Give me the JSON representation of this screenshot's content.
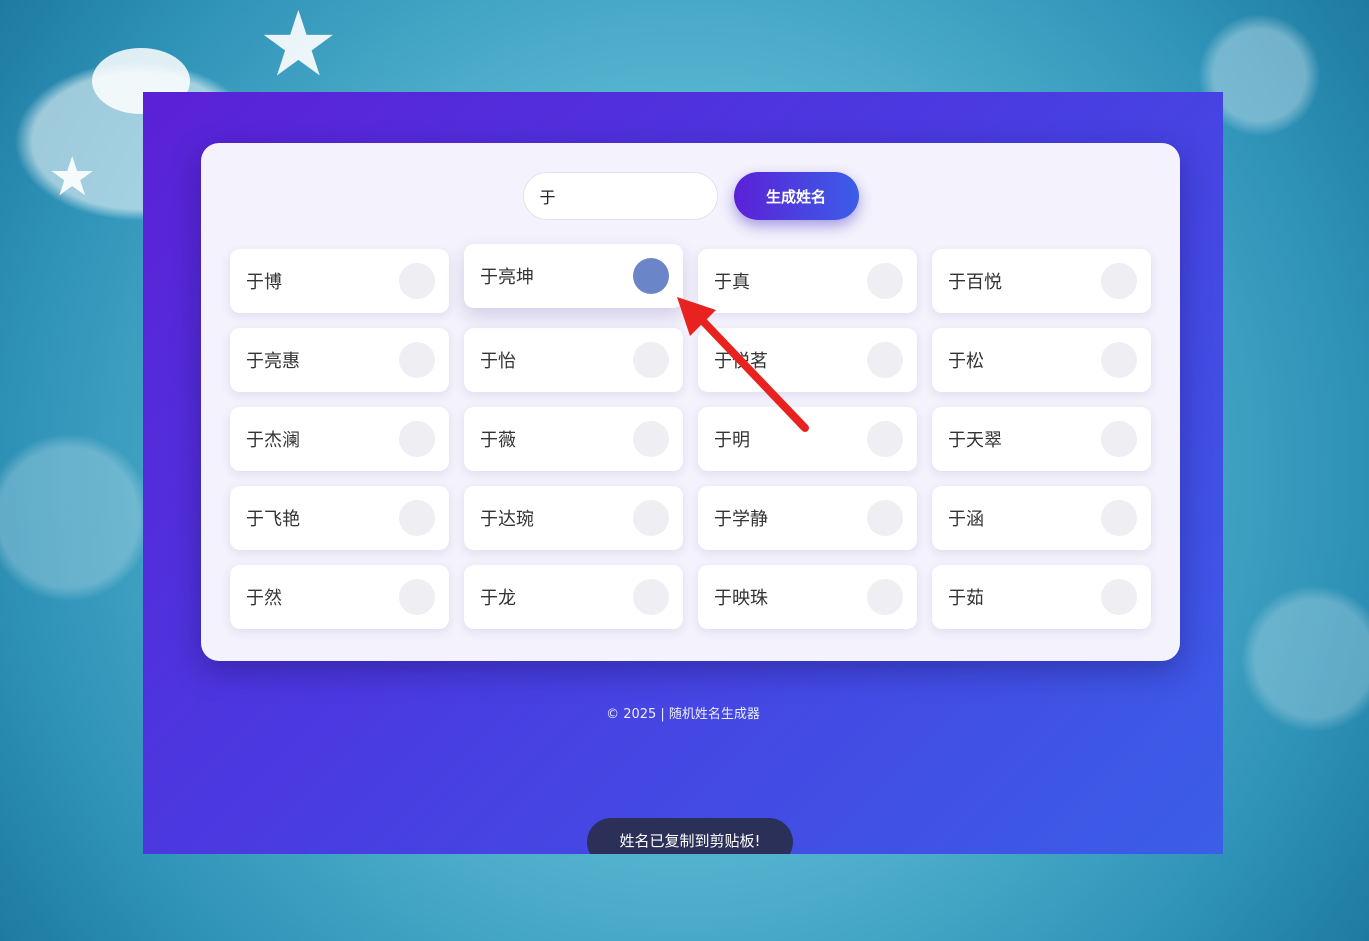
{
  "controls": {
    "input_value": "于",
    "input_placeholder": "",
    "generate_label": "生成姓名"
  },
  "names": [
    {
      "label": "于博"
    },
    {
      "label": "于亮坤",
      "active": true
    },
    {
      "label": "于真"
    },
    {
      "label": "于百悦"
    },
    {
      "label": "于亮惠"
    },
    {
      "label": "于怡"
    },
    {
      "label": "于悦茗"
    },
    {
      "label": "于松"
    },
    {
      "label": "于杰澜"
    },
    {
      "label": "于薇"
    },
    {
      "label": "于明"
    },
    {
      "label": "于天翠"
    },
    {
      "label": "于飞艳"
    },
    {
      "label": "于达琬"
    },
    {
      "label": "于学静"
    },
    {
      "label": "于涵"
    },
    {
      "label": "于然"
    },
    {
      "label": "于龙"
    },
    {
      "label": "于映珠"
    },
    {
      "label": "于茹"
    }
  ],
  "footer": {
    "text": "© 2025 | 随机姓名生成器"
  },
  "toast": {
    "text": "姓名已复制到剪贴板!"
  },
  "colors": {
    "gradient_start": "#5b21d6",
    "gradient_end": "#3b5ee8",
    "copy_active": "#6b86c8",
    "annotation_arrow": "#e8231f"
  },
  "icons": {
    "copy": "copy-icon",
    "annotation": "arrow-icon"
  }
}
